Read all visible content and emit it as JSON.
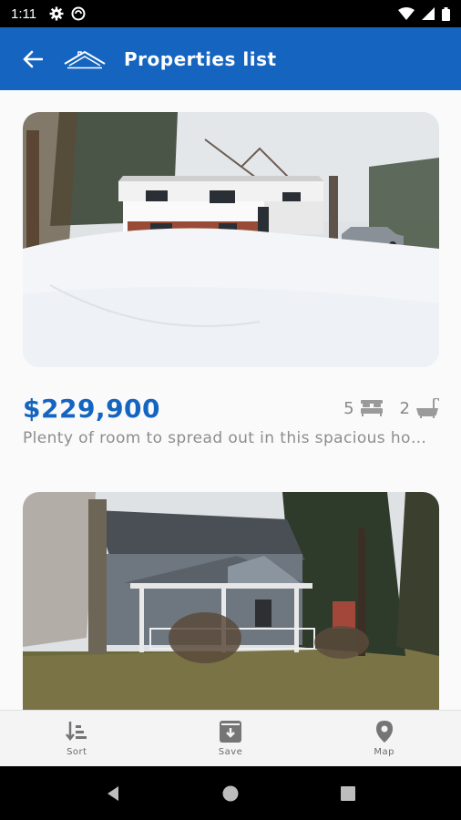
{
  "status_bar": {
    "time": "1:11"
  },
  "app_bar": {
    "title": "Properties list"
  },
  "listings": [
    {
      "price": "$229,900",
      "bedrooms": "5",
      "bathrooms": "2",
      "description": "Plenty of room to spread out in this spacious home"
    },
    {
      "price": "",
      "bedrooms": "",
      "bathrooms": "",
      "description": ""
    }
  ],
  "bottom_nav": {
    "sort_label": "Sort",
    "save_label": "Save",
    "map_label": "Map"
  },
  "colors": {
    "primary": "#1565c0",
    "muted_text": "#8d8d8d"
  },
  "icons": [
    "back-arrow-icon",
    "house-logo-icon",
    "bed-icon",
    "bathtub-icon",
    "sort-icon",
    "save-icon",
    "map-pin-icon"
  ]
}
